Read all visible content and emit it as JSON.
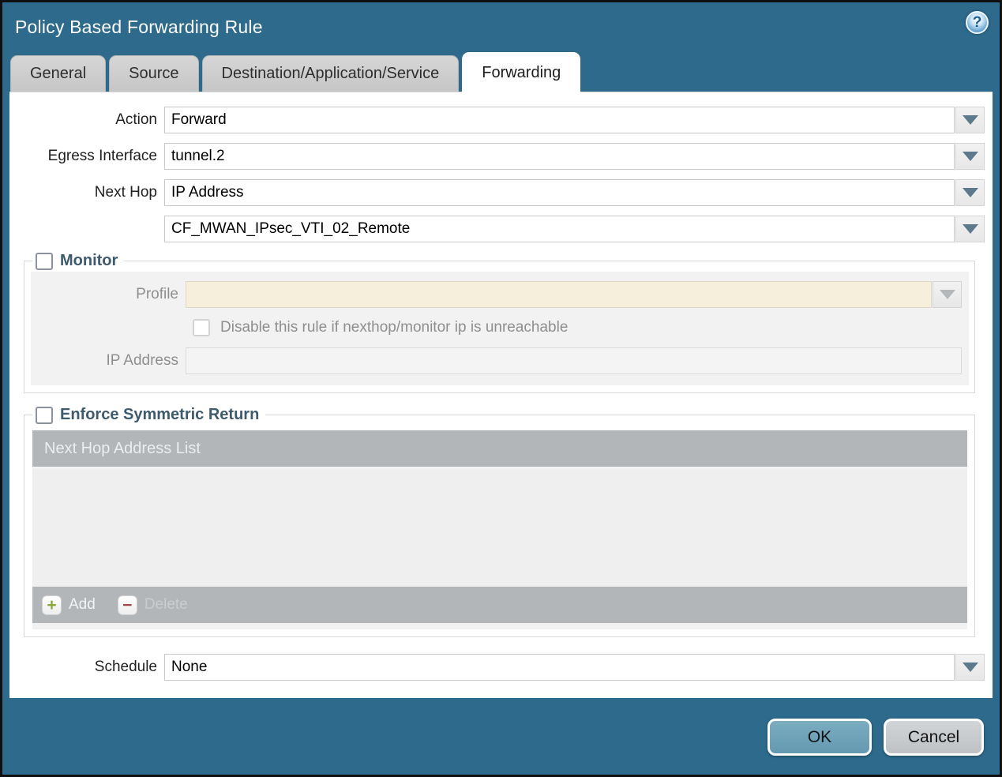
{
  "window": {
    "title": "Policy Based Forwarding Rule",
    "help_glyph": "?"
  },
  "tabs": [
    {
      "label": "General",
      "active": false
    },
    {
      "label": "Source",
      "active": false
    },
    {
      "label": "Destination/Application/Service",
      "active": false
    },
    {
      "label": "Forwarding",
      "active": true
    }
  ],
  "form": {
    "action": {
      "label": "Action",
      "value": "Forward"
    },
    "egress_interface": {
      "label": "Egress Interface",
      "value": "tunnel.2"
    },
    "next_hop": {
      "label": "Next Hop",
      "value": "IP Address"
    },
    "next_hop_address": {
      "value": "CF_MWAN_IPsec_VTI_02_Remote"
    },
    "schedule": {
      "label": "Schedule",
      "value": "None"
    }
  },
  "monitor": {
    "legend": "Monitor",
    "checked": false,
    "profile": {
      "label": "Profile",
      "value": ""
    },
    "disable_rule": {
      "label": "Disable this rule if nexthop/monitor ip is unreachable",
      "checked": false
    },
    "ip_address": {
      "label": "IP Address",
      "value": ""
    }
  },
  "symmetric_return": {
    "legend": "Enforce Symmetric Return",
    "checked": false,
    "table": {
      "header": "Next Hop Address List",
      "rows": []
    },
    "add_label": "Add",
    "delete_label": "Delete"
  },
  "footer": {
    "ok_label": "OK",
    "cancel_label": "Cancel"
  },
  "colors": {
    "chrome_teal": "#2d6a8b",
    "window_border": "#101010",
    "inactive_tab": "#c9c9c9",
    "panel_gray": "#f2f2f2",
    "disabled_beige": "#f5efdb",
    "table_gray": "#b2b6b8",
    "legend_text": "#3e5a6d",
    "ok_button": "#6fa3b8",
    "cancel_button": "#c7cacc",
    "add_green": "#8ca83d",
    "delete_red": "#9e4a44"
  }
}
